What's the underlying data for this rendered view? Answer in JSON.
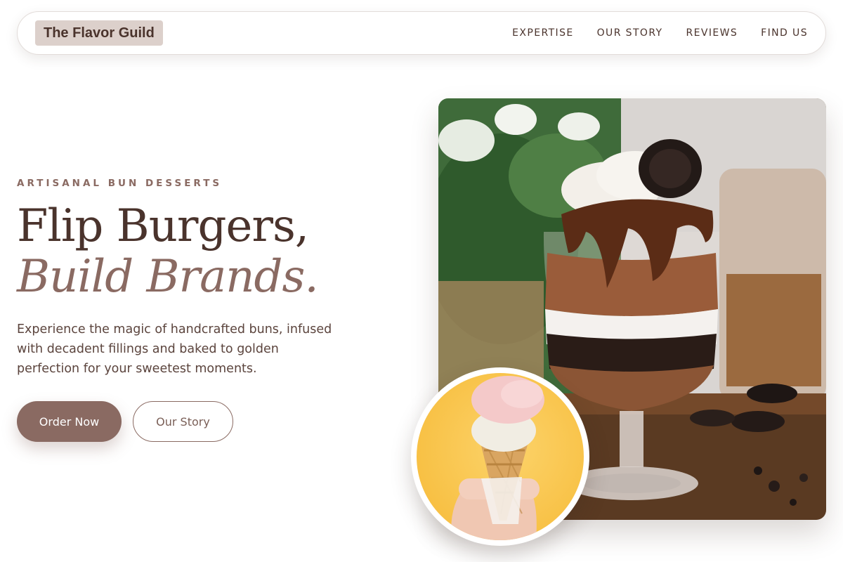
{
  "nav": {
    "brand": "The Flavor Guild",
    "links": [
      {
        "label": "EXPERTISE"
      },
      {
        "label": "OUR STORY"
      },
      {
        "label": "REVIEWS"
      },
      {
        "label": "FIND US"
      }
    ]
  },
  "hero": {
    "eyebrow": "ARTISANAL BUN DESSERTS",
    "headline_line1": "Flip Burgers,",
    "headline_line2": "Build Brands.",
    "description": "Experience the magic of handcrafted buns, infused with decadent fillings and baked to golden perfection for your sweetest moments.",
    "primary_button": "Order Now",
    "secondary_button": "Our Story"
  },
  "images": {
    "main": "chocolate-parfait-photo",
    "circle": "ice-cream-cone-photo"
  },
  "colors": {
    "primary": "#8a6a62",
    "text_dark": "#4a332c",
    "brand_bg": "#dcd0cb"
  }
}
